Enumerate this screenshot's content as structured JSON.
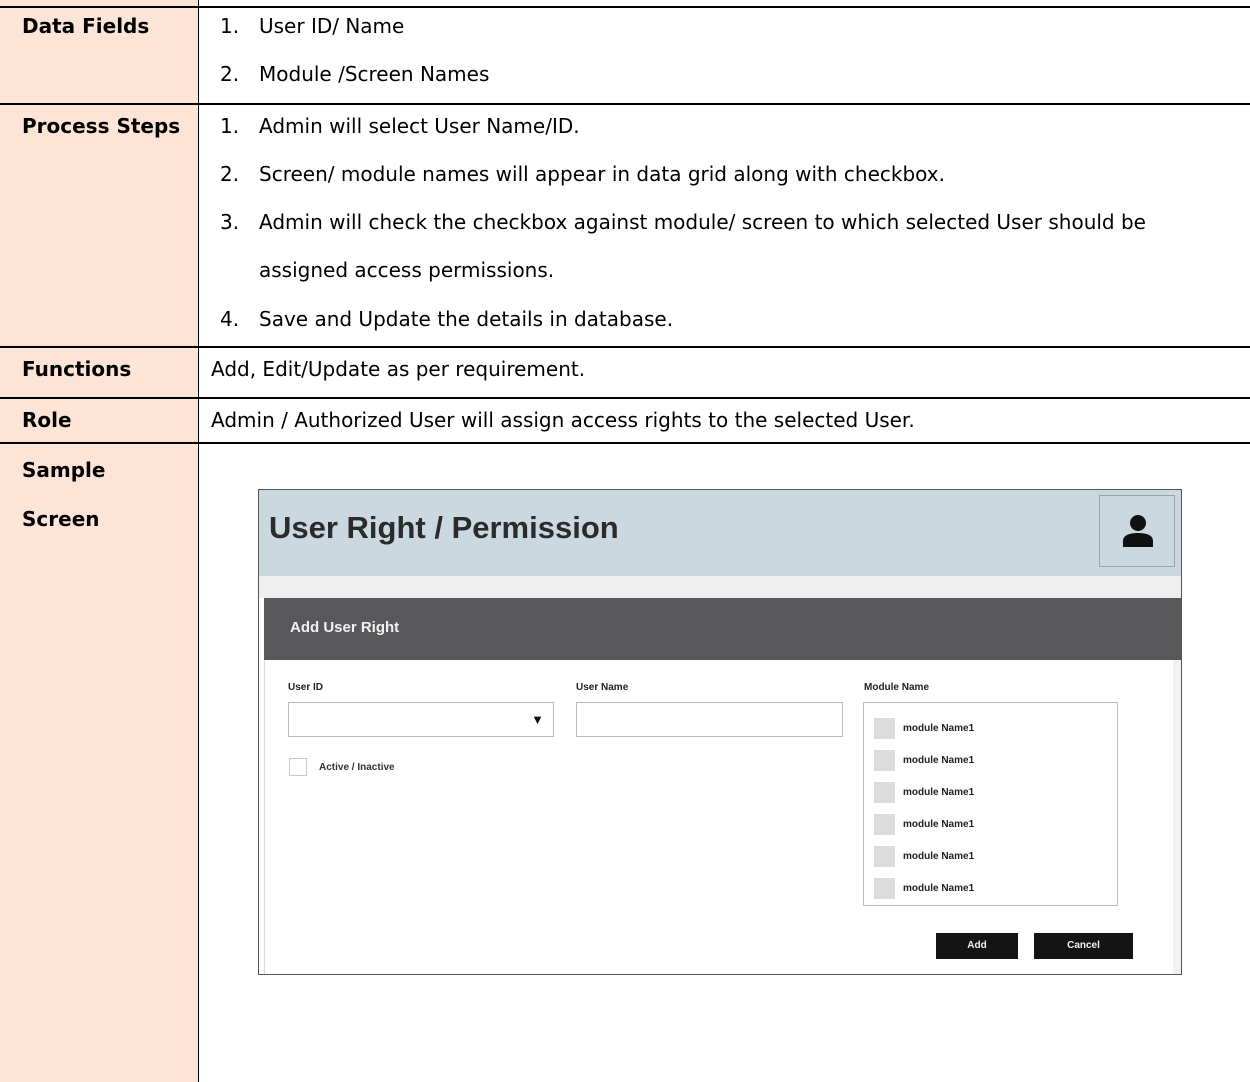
{
  "rows": {
    "data_fields": {
      "label": "Data Fields",
      "items": [
        {
          "num": "1.",
          "text": "User ID/ Name"
        },
        {
          "num": "2.",
          "text": "Module /Screen Names"
        }
      ]
    },
    "process_steps": {
      "label": "Process Steps",
      "items": [
        {
          "num": "1.",
          "text": "Admin will select User Name/ID."
        },
        {
          "num": "2.",
          "text": "Screen/ module names will appear in data grid along with checkbox."
        },
        {
          "num": "3.",
          "text": "Admin will check the checkbox against module/ screen to which selected User should be",
          "continuation": "assigned access permissions."
        },
        {
          "num": "4.",
          "text": "Save and Update the details in database."
        }
      ]
    },
    "functions": {
      "label": "Functions",
      "text": "Add, Edit/Update as per requirement."
    },
    "role": {
      "label": "Role",
      "text": "Admin / Authorized User will assign access rights to the selected User."
    },
    "sample_screen": {
      "label_line1": "Sample",
      "label_line2": "Screen"
    }
  },
  "mockup": {
    "title": "User Right / Permission",
    "avatar_icon": "user-icon",
    "panel_title": "Add  User Right",
    "user_id_label": "User ID",
    "user_id_value": "",
    "dropdown_icon": "▼",
    "user_name_label": "User Name",
    "user_name_value": "",
    "active_label": "Active / Inactive",
    "module_name_label": "Module Name",
    "modules": [
      "module  Name1",
      "module  Name1",
      "module  Name1",
      "module  Name1",
      "module  Name1",
      "module  Name1"
    ],
    "add_label": "Add",
    "cancel_label": "Cancel"
  },
  "colors": {
    "label_bg": "#fce4d6",
    "mock_header_bg": "#ccd8e0",
    "panel_bar_bg": "#58585a",
    "button_bg": "#141414"
  }
}
